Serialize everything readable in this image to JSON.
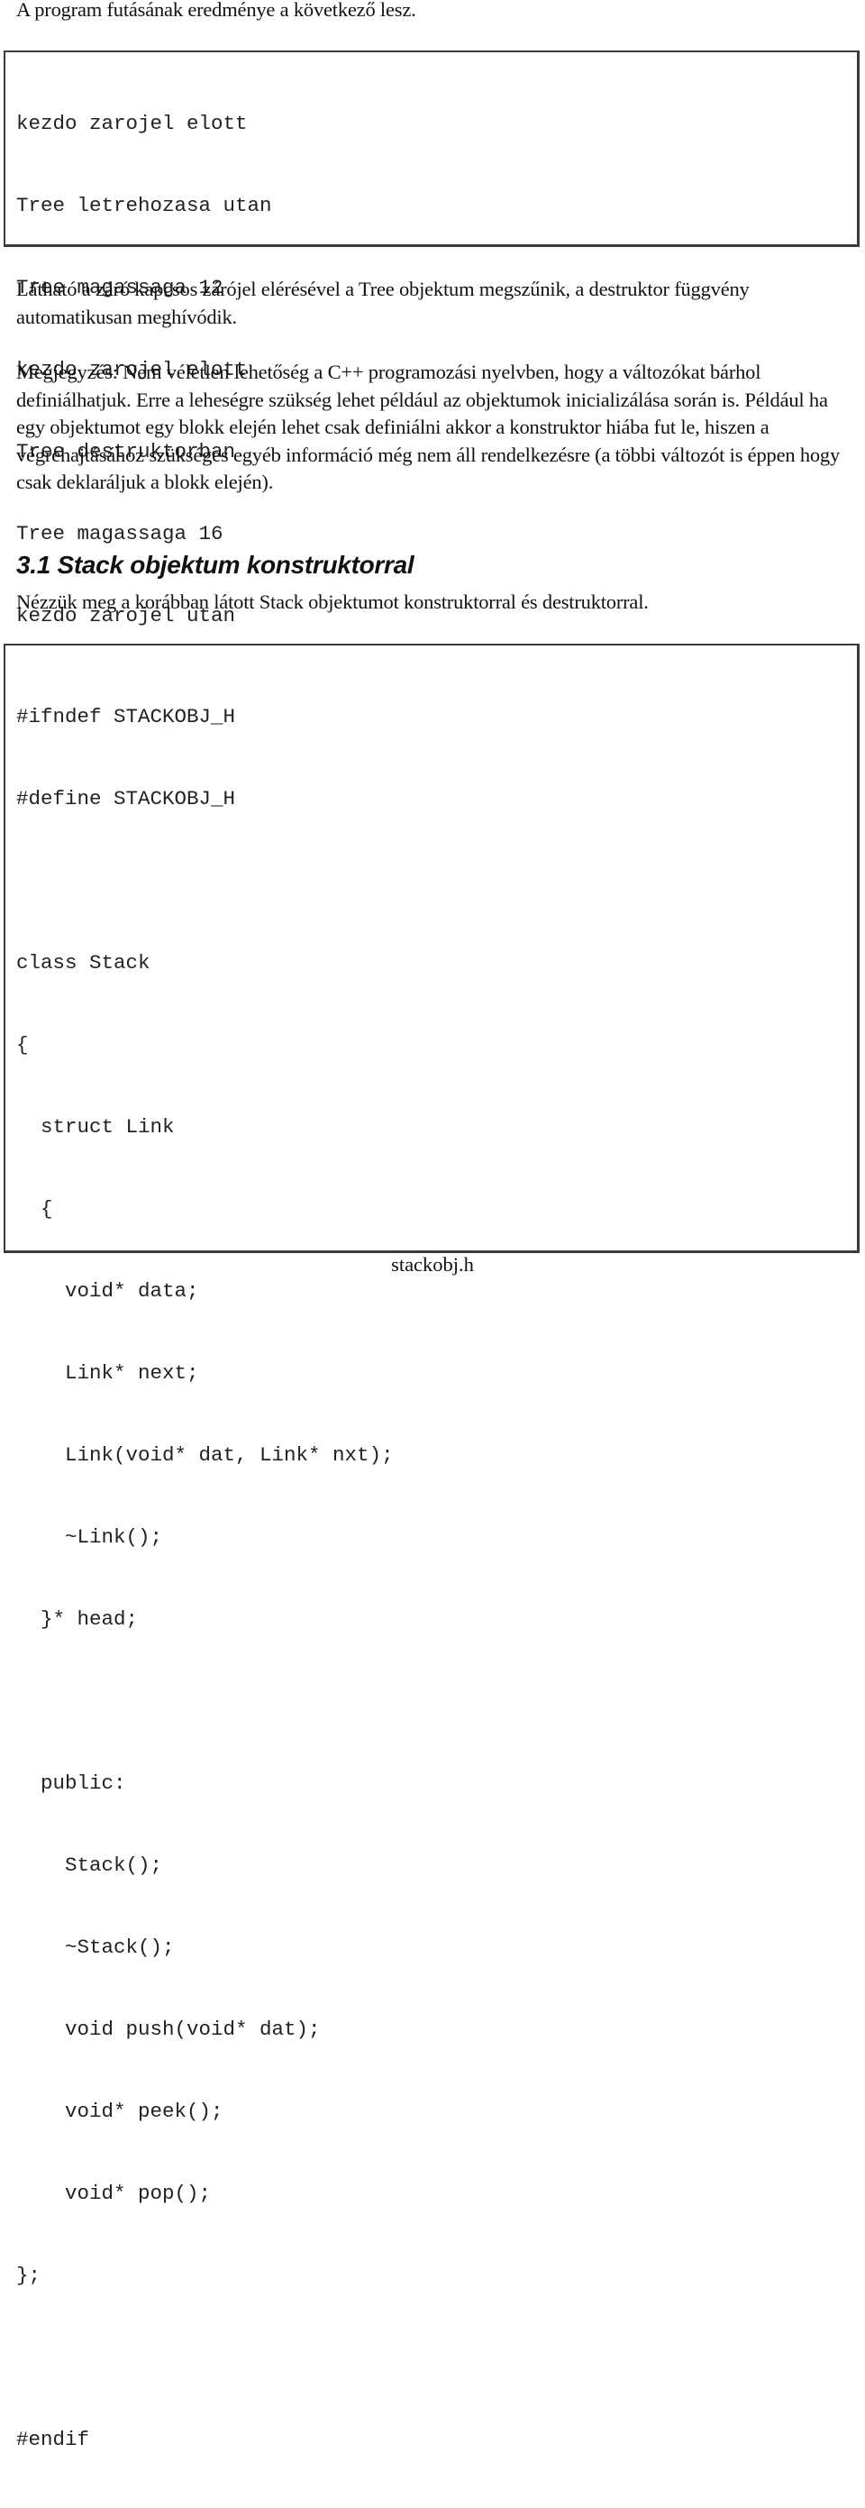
{
  "intro": "A program futásának eredménye a következő lesz.",
  "output_box": {
    "lines": [
      "kezdo zarojel elott",
      "Tree letrehozasa utan",
      "Tree magassaga 12",
      "kezdo zarojel elott",
      "Tree destruktorban",
      "Tree magassaga 16",
      "kezdo zarojel utan"
    ]
  },
  "paragraphs": [
    "Látható a záró kapcsos zárójel elérésével a Tree objektum megszűnik, a destruktor függvény automatikusan meghívódik.",
    "Megjegyzés: Nem véletlen lehetőség a C++ programozási nyelvben, hogy a változókat bárhol definiálhatjuk. Erre a leheségre szükség lehet például az objektumok inicializálása során is. Például ha egy objektumot egy blokk elején lehet csak definiálni akkor a konstruktor hiába fut le, hiszen a végrehajtásához szükséges egyéb információ még nem áll rendelkezésre (a többi változót is éppen hogy csak deklaráljuk a blokk elején)."
  ],
  "section": {
    "heading": "3.1 Stack objektum konstruktorral",
    "intro": "Nézzük meg a korábban látott Stack objektumot konstruktorral és destruktorral."
  },
  "code_box": {
    "lines": [
      "#ifndef STACKOBJ_H",
      "#define STACKOBJ_H",
      "",
      "class Stack",
      "{",
      "  struct Link",
      "  {",
      "    void* data;",
      "    Link* next;",
      "    Link(void* dat, Link* nxt);",
      "    ~Link();",
      "  }* head;",
      "",
      "  public:",
      "    Stack();",
      "    ~Stack();",
      "    void push(void* dat);",
      "    void* peek();",
      "    void* pop();",
      "};",
      "",
      "#endif"
    ],
    "caption": "stackobj.h"
  }
}
